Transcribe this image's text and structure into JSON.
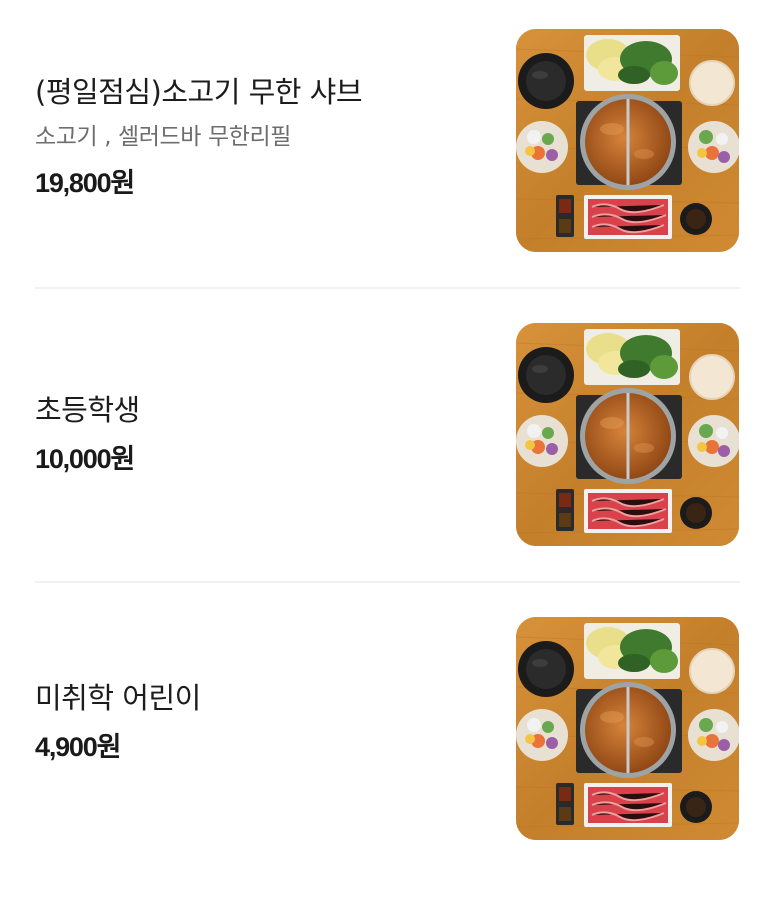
{
  "menu": {
    "items": [
      {
        "name": "(평일점심)소고기 무한 샤브",
        "description": "소고기 , 셀러드바 무한리필",
        "price": "19,800원",
        "image": "shabu-shabu-set-photo"
      },
      {
        "name": "초등학생",
        "description": "",
        "price": "10,000원",
        "image": "shabu-shabu-set-photo"
      },
      {
        "name": "미취학 어린이",
        "description": "",
        "price": "4,900원",
        "image": "shabu-shabu-set-photo"
      }
    ]
  },
  "colors": {
    "table_wood": "#c9852e",
    "broth": "#b8611c",
    "beef": "#d9424a",
    "divider": "#f1f1f1"
  }
}
